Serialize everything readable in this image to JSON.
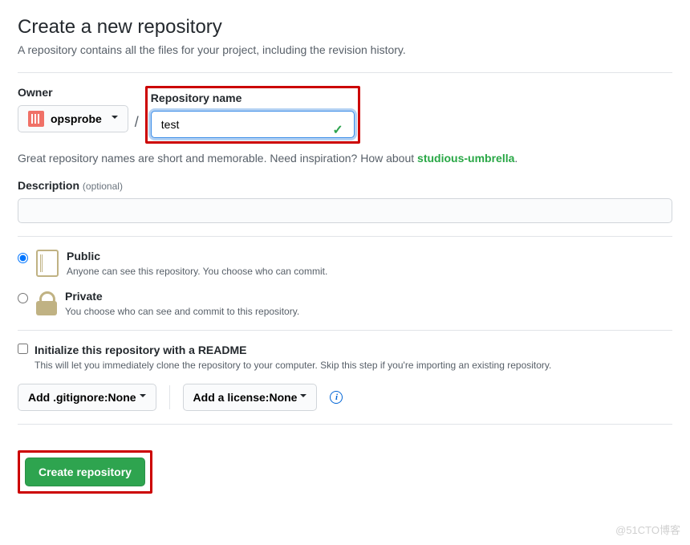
{
  "header": {
    "title": "Create a new repository",
    "subtitle": "A repository contains all the files for your project, including the revision history."
  },
  "owner": {
    "label": "Owner",
    "name": "opsprobe"
  },
  "repo": {
    "label": "Repository name",
    "value": "test"
  },
  "hint": {
    "prefix": "Great repository names are short and memorable. Need inspiration? How about ",
    "suggested": "studious-umbrella",
    "suffix": "."
  },
  "description": {
    "label": "Description",
    "optional_text": "(optional)",
    "value": ""
  },
  "visibility": {
    "public": {
      "title": "Public",
      "sub": "Anyone can see this repository. You choose who can commit."
    },
    "private": {
      "title": "Private",
      "sub": "You choose who can see and commit to this repository."
    }
  },
  "init": {
    "title": "Initialize this repository with a README",
    "sub": "This will let you immediately clone the repository to your computer. Skip this step if you're importing an existing repository."
  },
  "dropdowns": {
    "gitignore_prefix": "Add .gitignore: ",
    "gitignore_value": "None",
    "license_prefix": "Add a license: ",
    "license_value": "None"
  },
  "submit": {
    "label": "Create repository"
  },
  "watermark": "@51CTO博客"
}
